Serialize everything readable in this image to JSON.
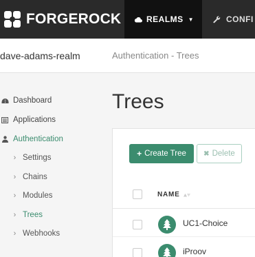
{
  "header": {
    "brand": "FORGEROCK",
    "realms_label": "REALMS",
    "config_label": "CONFI"
  },
  "realmbar": {
    "realm_name": "dave-adams-realm",
    "breadcrumb": "Authentication - Trees"
  },
  "sidebar": {
    "items": [
      {
        "label": "Dashboard",
        "icon": "dashboard-icon"
      },
      {
        "label": "Applications",
        "icon": "list-icon"
      },
      {
        "label": "Authentication",
        "icon": "user-icon"
      }
    ],
    "subitems": [
      {
        "label": "Settings"
      },
      {
        "label": "Chains"
      },
      {
        "label": "Modules"
      },
      {
        "label": "Trees"
      },
      {
        "label": "Webhooks"
      }
    ]
  },
  "main": {
    "title": "Trees",
    "create_label": "Create Tree",
    "delete_label": "Delete",
    "column_name": "NAME",
    "rows": [
      {
        "name": "UC1-Choice"
      },
      {
        "name": "iProov"
      }
    ]
  },
  "colors": {
    "accent": "#3b8c6e",
    "topbar": "#2a2a2a",
    "active_nav": "#111111"
  }
}
